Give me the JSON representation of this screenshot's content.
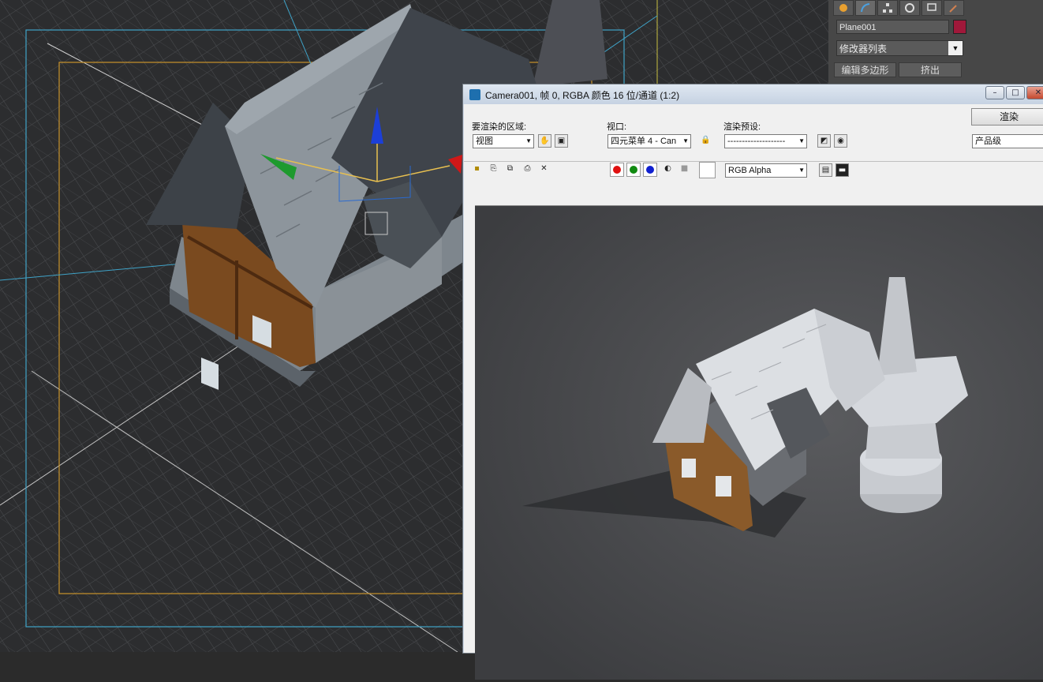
{
  "command_panel": {
    "tab_icons": [
      "sun-icon",
      "arc-icon",
      "hierarchy-icon",
      "motion-icon",
      "display-icon",
      "hammer-icon"
    ],
    "object_name": "Plane001",
    "object_color": "#a0183a",
    "modifier_list": "修改器列表",
    "edit_poly_button": "编辑多边形",
    "extrude_button": "挤出"
  },
  "render_window": {
    "title": "Camera001, 帧 0, RGBA 颜色 16 位/通道 (1:2)",
    "area_label": "要渲染的区域:",
    "area_value": "视图",
    "viewport_label": "视口:",
    "viewport_value": "四元菜单 4 - Can",
    "preset_label": "渲染预设:",
    "preset_value": "--------------------",
    "render_button": "渲染",
    "quality_value": "产品级",
    "channel_value": "RGB Alpha",
    "channel_colors": [
      "#e01010",
      "#108a10",
      "#1020d0"
    ]
  }
}
